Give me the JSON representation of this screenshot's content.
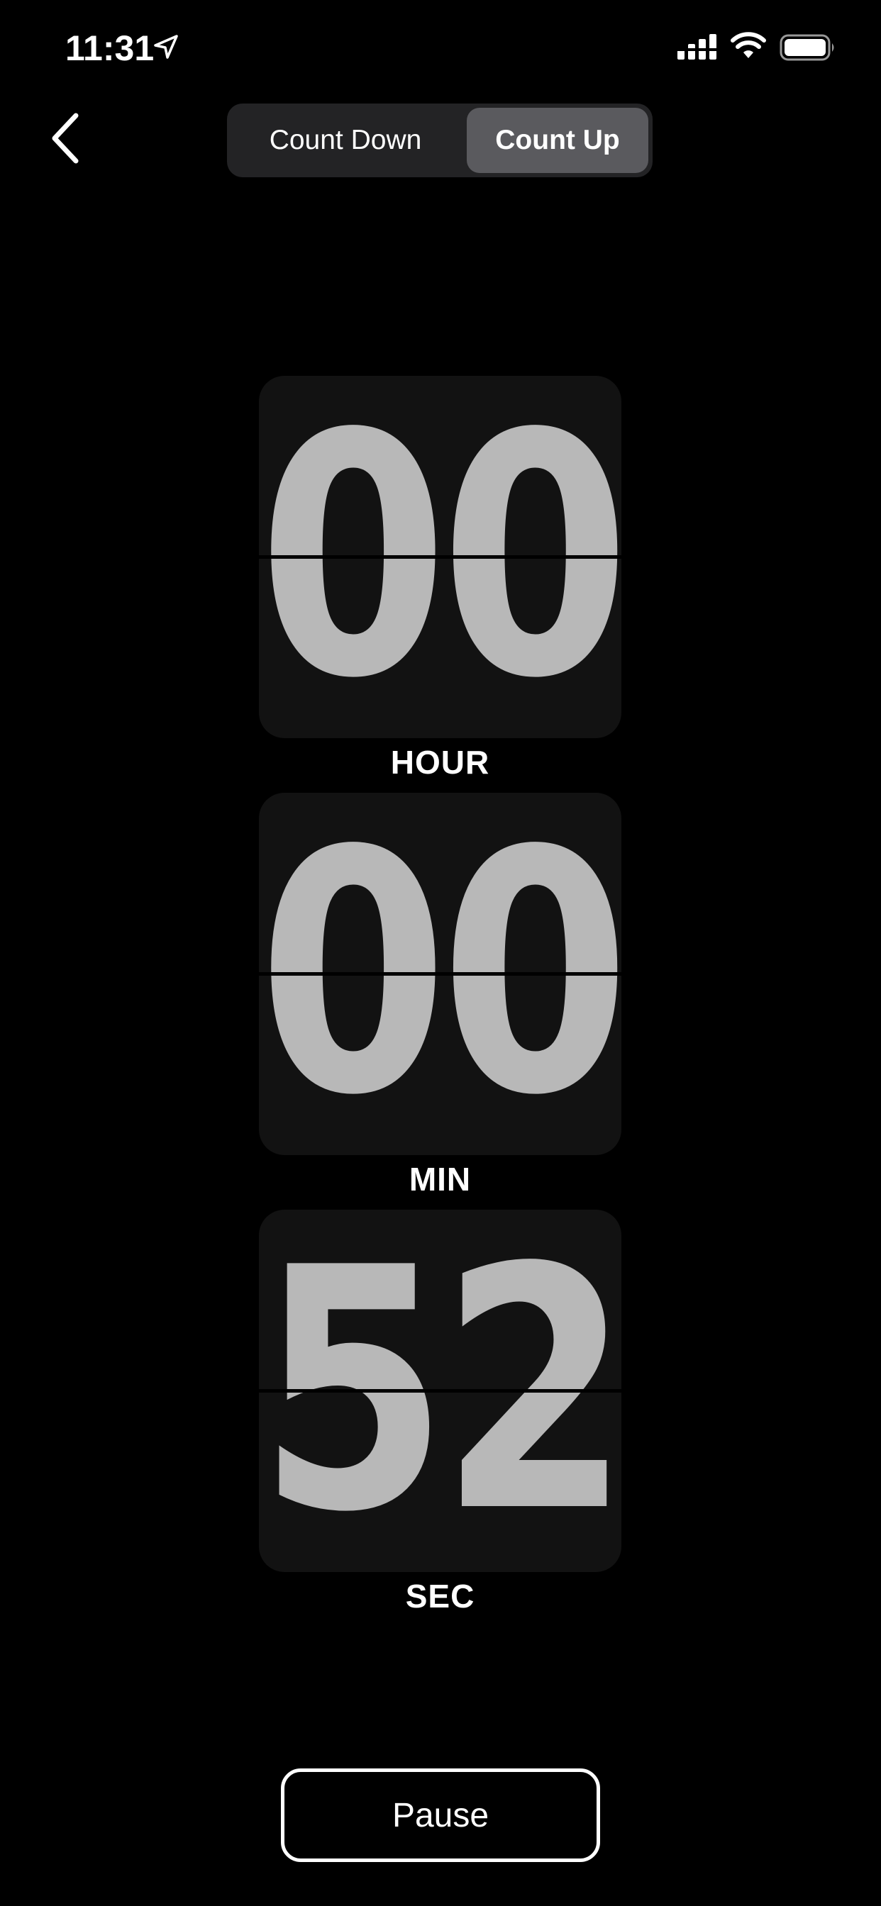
{
  "status_bar": {
    "time": "11:31",
    "icons": [
      "location-arrow-icon",
      "cellular-signal-icon",
      "wifi-icon",
      "battery-icon"
    ]
  },
  "header": {
    "back_icon": "chevron-left-icon",
    "segments": [
      {
        "label": "Count Down",
        "selected": false
      },
      {
        "label": "Count Up",
        "selected": true
      }
    ]
  },
  "timer": {
    "hours": {
      "value": "00",
      "label": "HOUR"
    },
    "minutes": {
      "value": "00",
      "label": "MIN"
    },
    "seconds": {
      "value": "52",
      "label": "SEC"
    }
  },
  "controls": {
    "pause_label": "Pause"
  },
  "colors": {
    "background": "#000000",
    "card": "#121212",
    "digit": "#b8b8b8",
    "segment_bg": "#232325",
    "segment_selected": "#5a5a5e",
    "text": "#ffffff"
  }
}
